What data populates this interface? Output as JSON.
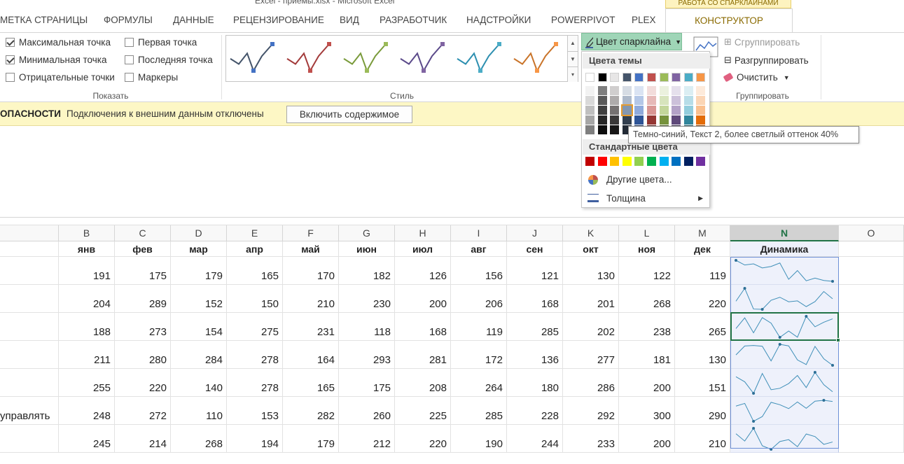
{
  "window": {
    "title": "Excel - приемы.xlsx - Microsoft Excel"
  },
  "context_tab_group": "РАБОТА СО СПАРКЛАЙНАМИ",
  "tabs": [
    {
      "label": "МЕТКА СТРАНИЦЫ"
    },
    {
      "label": "ФОРМУЛЫ"
    },
    {
      "label": "ДАННЫЕ"
    },
    {
      "label": "РЕЦЕНЗИРОВАНИЕ"
    },
    {
      "label": "ВИД"
    },
    {
      "label": "РАЗРАБОТЧИК"
    },
    {
      "label": "НАДСТРОЙКИ"
    },
    {
      "label": "POWERPIVOT"
    },
    {
      "label": "PLEX"
    }
  ],
  "active_tab": "КОНСТРУКТОР",
  "show_group": {
    "label": "Показать",
    "options": [
      {
        "label": "Максимальная точка",
        "checked": true
      },
      {
        "label": "Минимальная точка",
        "checked": true
      },
      {
        "label": "Отрицательные точки",
        "checked": false
      },
      {
        "label": "Первая точка",
        "checked": false
      },
      {
        "label": "Последняя точка",
        "checked": false
      },
      {
        "label": "Маркеры",
        "checked": false
      }
    ]
  },
  "style_group": {
    "label": "Стиль",
    "tiles": [
      {
        "line": "#44546a",
        "marker": "#4472c4"
      },
      {
        "line": "#a33b3b",
        "marker": "#c0504d"
      },
      {
        "line": "#7a9b3b",
        "marker": "#9bbb59"
      },
      {
        "line": "#5b4a8a",
        "marker": "#8064a2"
      },
      {
        "line": "#2d8fb0",
        "marker": "#4bacc6"
      },
      {
        "line": "#c9742a",
        "marker": "#f79646"
      }
    ]
  },
  "sparkline_color_button": "Цвет спарклайна",
  "group_group": {
    "label": "Группировать",
    "group_btn": "Сгруппировать",
    "ungroup_btn": "Разгруппировать",
    "clear_btn": "Очистить"
  },
  "palette": {
    "theme_header": "Цвета темы",
    "standard_header": "Стандартные цвета",
    "theme_top": [
      "#ffffff",
      "#000000",
      "#e7e6e6",
      "#44546a",
      "#4472c4",
      "#c0504d",
      "#9bbb59",
      "#8064a2",
      "#4bacc6",
      "#f79646"
    ],
    "theme_shades": [
      [
        "#f2f2f2",
        "#7f7f7f",
        "#d0cece",
        "#d6dce4",
        "#dae3f3",
        "#f2dcdb",
        "#ebf1de",
        "#e5e0ec",
        "#dbeef3",
        "#fdeada"
      ],
      [
        "#d9d9d9",
        "#595959",
        "#aeabab",
        "#adb9ca",
        "#b4c7e7",
        "#e6b9b8",
        "#d7e4bd",
        "#ccc1da",
        "#b7dde8",
        "#fbd5b5"
      ],
      [
        "#bfbfbf",
        "#3f3f3f",
        "#757171",
        "#8497b0",
        "#8faadc",
        "#d99694",
        "#c3d69b",
        "#b3a2c7",
        "#93cddd",
        "#fac08f"
      ],
      [
        "#a6a6a6",
        "#262626",
        "#3a3838",
        "#323f4f",
        "#2f5597",
        "#953734",
        "#76923c",
        "#5f497a",
        "#31859c",
        "#e36c09"
      ],
      [
        "#7f7f7f",
        "#0d0d0d",
        "#171616",
        "#222a35",
        "#203864",
        "#632423",
        "#4f6128",
        "#3f3151",
        "#205867",
        "#974806"
      ]
    ],
    "standard": [
      "#c00000",
      "#ff0000",
      "#ffc000",
      "#ffff00",
      "#92d050",
      "#00b050",
      "#00b0f0",
      "#0070c0",
      "#002060",
      "#7030a0"
    ],
    "more_colors": "Другие цвета...",
    "weight": "Толщина"
  },
  "tooltip": "Темно-синий, Текст 2, более светлый оттенок 40%",
  "message_bar": {
    "title": "ОПАСНОСТИ",
    "text": "Подключения к внешним данным отключены",
    "button": "Включить содержимое"
  },
  "sheet": {
    "columns": [
      "B",
      "C",
      "D",
      "E",
      "F",
      "G",
      "H",
      "I",
      "J",
      "K",
      "L",
      "M",
      "N",
      "O"
    ],
    "selected_column": "N",
    "headers": [
      "янв",
      "фев",
      "мар",
      "апр",
      "май",
      "июн",
      "июл",
      "авг",
      "сен",
      "окт",
      "ноя",
      "дек",
      "Динамика"
    ],
    "row_labels": [
      "",
      "",
      "",
      "",
      "",
      "управлять",
      ""
    ],
    "rows": [
      [
        191,
        175,
        179,
        165,
        170,
        182,
        126,
        156,
        121,
        130,
        122,
        119
      ],
      [
        204,
        289,
        152,
        150,
        210,
        230,
        200,
        206,
        168,
        201,
        268,
        220
      ],
      [
        188,
        273,
        154,
        275,
        231,
        118,
        168,
        119,
        285,
        202,
        238,
        265
      ],
      [
        211,
        280,
        284,
        278,
        164,
        293,
        281,
        172,
        136,
        277,
        181,
        130
      ],
      [
        255,
        220,
        140,
        278,
        165,
        175,
        208,
        264,
        180,
        286,
        200,
        151
      ],
      [
        248,
        272,
        110,
        153,
        282,
        260,
        225,
        285,
        228,
        292,
        300,
        290
      ],
      [
        245,
        214,
        268,
        194,
        179,
        212,
        220,
        190,
        244,
        233,
        200,
        210
      ]
    ]
  }
}
